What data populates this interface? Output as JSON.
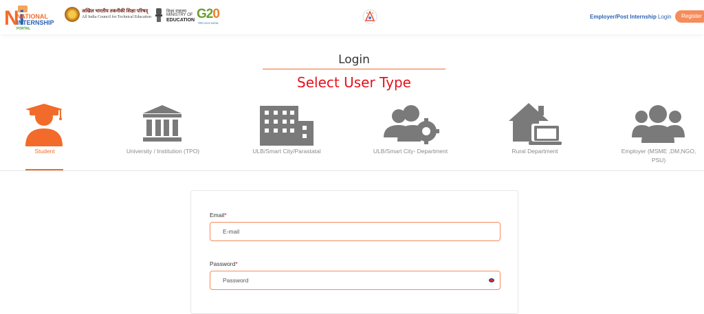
{
  "header": {
    "logo_nip": {
      "line1": "NATIONAL",
      "line2": "INTERNSHIP",
      "line3": "PORTAL"
    },
    "logo_aicte": {
      "hindi": "अखिल भारतीय तकनीकी शिक्षा परिषद्",
      "english": "All India Council for Technical Education"
    },
    "logo_moe": {
      "hindi": "शिक्षा मंत्रालय",
      "line1": "MINISTRY OF",
      "line2": "EDUCATION"
    },
    "logo_g20": {
      "text_g2": "G2",
      "text_zero": "0",
      "sub": "भारत 2023 INDIA"
    },
    "nav": {
      "employer_label": "Employer/Post Internship",
      "login_label": "Login",
      "register_label": "Register"
    }
  },
  "main": {
    "login_title": "Login",
    "select_title": "Select User Type",
    "user_types": [
      {
        "label": "Student",
        "icon": "student-icon",
        "active": true
      },
      {
        "label": "University / Institution (TPO)",
        "icon": "university-icon",
        "active": false
      },
      {
        "label": "ULB/Smart City/Parastatal",
        "icon": "city-building-icon",
        "active": false
      },
      {
        "label": "ULB/Smart City- Department",
        "icon": "users-gear-icon",
        "active": false
      },
      {
        "label": "Rural Department",
        "icon": "house-laptop-icon",
        "active": false
      },
      {
        "label": "Employer (MSME ,DM,NGO, PSU)",
        "icon": "people-group-icon",
        "active": false
      }
    ],
    "form": {
      "email_label": "Email",
      "email_placeholder": "E-mail",
      "email_value": "",
      "password_label": "Password",
      "password_placeholder": "Password",
      "password_value": ""
    }
  },
  "colors": {
    "accent": "#f26b2a",
    "title_red": "#e8101a",
    "link_blue": "#2b63b5",
    "icon_gray": "#7a7a7a",
    "register_bg": "#f58c5b"
  }
}
